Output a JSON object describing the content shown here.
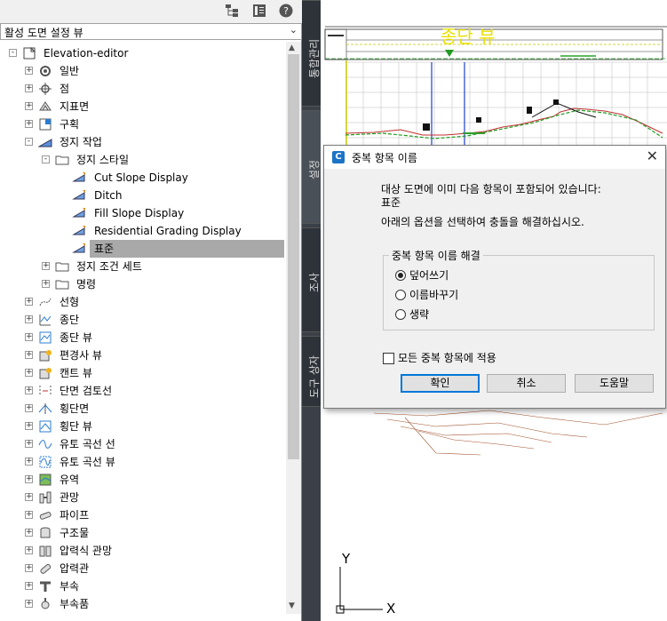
{
  "panel": {
    "drawing_selector": {
      "value": "활성 도면 설정 뷰"
    },
    "tree": [
      {
        "label": "Elevation-editor",
        "icon": "drawing-icon",
        "level": 0,
        "expander": "-"
      },
      {
        "label": "일반",
        "icon": "gear-icon",
        "level": 1,
        "expander": "+"
      },
      {
        "label": "점",
        "icon": "point-icon",
        "level": 1,
        "expander": "+"
      },
      {
        "label": "지표면",
        "icon": "surface-icon",
        "level": 1,
        "expander": "+"
      },
      {
        "label": "구획",
        "icon": "parcel-icon",
        "level": 1,
        "expander": "+"
      },
      {
        "label": "정지 작업",
        "icon": "grading-icon",
        "level": 1,
        "expander": "-"
      },
      {
        "label": "정지 스타일",
        "icon": "folder-icon",
        "level": 2,
        "expander": "-"
      },
      {
        "label": "Cut Slope Display",
        "icon": "grading-style-icon",
        "level": 3,
        "expander": ""
      },
      {
        "label": "Ditch",
        "icon": "grading-style-icon",
        "level": 3,
        "expander": ""
      },
      {
        "label": "Fill Slope Display",
        "icon": "grading-style-icon",
        "level": 3,
        "expander": ""
      },
      {
        "label": "Residential Grading Display",
        "icon": "grading-style-icon",
        "level": 3,
        "expander": ""
      },
      {
        "label": "표준",
        "icon": "grading-style-icon",
        "level": 3,
        "expander": "",
        "selected": true
      },
      {
        "label": "정지 조건 세트",
        "icon": "folder-icon",
        "level": 2,
        "expander": "+"
      },
      {
        "label": "명령",
        "icon": "folder-icon",
        "level": 2,
        "expander": "+"
      },
      {
        "label": "선형",
        "icon": "alignment-icon",
        "level": 1,
        "expander": "+"
      },
      {
        "label": "종단",
        "icon": "profile-icon",
        "level": 1,
        "expander": "+"
      },
      {
        "label": "종단 뷰",
        "icon": "profile-view-icon",
        "level": 1,
        "expander": "+"
      },
      {
        "label": "편경사 뷰",
        "icon": "superelevation-view-icon",
        "level": 1,
        "expander": "+"
      },
      {
        "label": "캔트 뷰",
        "icon": "cant-view-icon",
        "level": 1,
        "expander": "+"
      },
      {
        "label": "단면 검토선",
        "icon": "sample-line-icon",
        "level": 1,
        "expander": "+"
      },
      {
        "label": "횡단면",
        "icon": "section-icon",
        "level": 1,
        "expander": "+"
      },
      {
        "label": "횡단 뷰",
        "icon": "section-view-icon",
        "level": 1,
        "expander": "+"
      },
      {
        "label": "유토 곡선 선",
        "icon": "mass-haul-line-icon",
        "level": 1,
        "expander": "+"
      },
      {
        "label": "유토 곡선 뷰",
        "icon": "mass-haul-view-icon",
        "level": 1,
        "expander": "+"
      },
      {
        "label": "유역",
        "icon": "catchment-icon",
        "level": 1,
        "expander": "+"
      },
      {
        "label": "관망",
        "icon": "pipe-network-icon",
        "level": 1,
        "expander": "+"
      },
      {
        "label": "파이프",
        "icon": "pipe-icon",
        "level": 1,
        "expander": "+"
      },
      {
        "label": "구조물",
        "icon": "structure-icon",
        "level": 1,
        "expander": "+"
      },
      {
        "label": "압력식 관망",
        "icon": "pressure-network-icon",
        "level": 1,
        "expander": "+"
      },
      {
        "label": "압력관",
        "icon": "pressure-pipe-icon",
        "level": 1,
        "expander": "+"
      },
      {
        "label": "부속",
        "icon": "fitting-icon",
        "level": 1,
        "expander": "+"
      },
      {
        "label": "부속품",
        "icon": "appurtenance-icon",
        "level": 1,
        "expander": "+"
      }
    ]
  },
  "tabs": [
    {
      "label": "통합관리"
    },
    {
      "label": "설정",
      "active": true
    },
    {
      "label": "조사"
    },
    {
      "label": "도구 상자"
    }
  ],
  "drawing": {
    "title_text": "종단 뷰",
    "ucs": {
      "x_label": "X",
      "y_label": "Y"
    }
  },
  "dialog": {
    "title": "중복 항목 이름",
    "close": "✕",
    "message_line1": "대상 도면에 이미 다음 항목이 포함되어 있습니다:",
    "item_name": "표준",
    "instruction": "아래의 옵션을 선택하여 충돌을 해결하십시오.",
    "group_label": "중복 항목 이름 해결",
    "options": [
      {
        "label": "덮어쓰기",
        "selected": true
      },
      {
        "label": "이름바꾸기",
        "selected": false
      },
      {
        "label": "생략",
        "selected": false
      }
    ],
    "apply_all_label": "모든 중복 항목에 적용",
    "apply_all_checked": false,
    "buttons": {
      "ok": "확인",
      "cancel": "취소",
      "help": "도움말"
    }
  },
  "colors": {
    "selection": "#a9a9a9",
    "tab_strip": "#3b4048",
    "default_button_border": "#0078d7",
    "title_yellow": "#e8e000"
  }
}
